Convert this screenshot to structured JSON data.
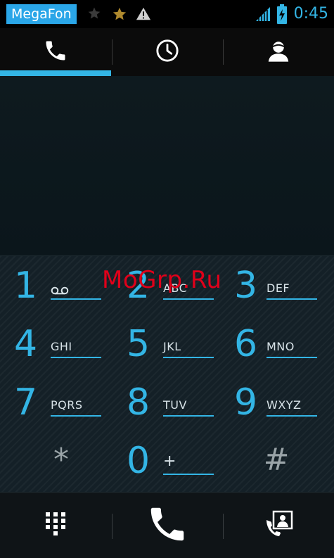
{
  "status_bar": {
    "carrier": "MegaFon",
    "time": "0:45",
    "icons": [
      "star-outline-icon",
      "star-filled-icon",
      "warning-icon",
      "signal-icon",
      "battery-charging-icon"
    ]
  },
  "tabs": [
    {
      "name": "phone-icon",
      "selected": true
    },
    {
      "name": "recent-clock-icon",
      "selected": false
    },
    {
      "name": "contacts-person-icon",
      "selected": false
    }
  ],
  "keypad": {
    "keys": [
      {
        "digit": "1",
        "letters": ""
      },
      {
        "digit": "2",
        "letters": "ABC"
      },
      {
        "digit": "3",
        "letters": "DEF"
      },
      {
        "digit": "4",
        "letters": "GHI"
      },
      {
        "digit": "5",
        "letters": "JKL"
      },
      {
        "digit": "6",
        "letters": "MNO"
      },
      {
        "digit": "7",
        "letters": "PQRS"
      },
      {
        "digit": "8",
        "letters": "TUV"
      },
      {
        "digit": "9",
        "letters": "WXYZ"
      },
      {
        "digit": "*",
        "letters": ""
      },
      {
        "digit": "0",
        "letters": "+"
      },
      {
        "digit": "#",
        "letters": ""
      }
    ]
  },
  "actions": [
    "dialpad-icon",
    "call-button-icon",
    "contacts-card-icon"
  ],
  "watermark": "MoGrp.Ru",
  "colors": {
    "accent": "#33b5e5",
    "carrier_bg": "#2aa6e8",
    "watermark": "#e0001a"
  }
}
